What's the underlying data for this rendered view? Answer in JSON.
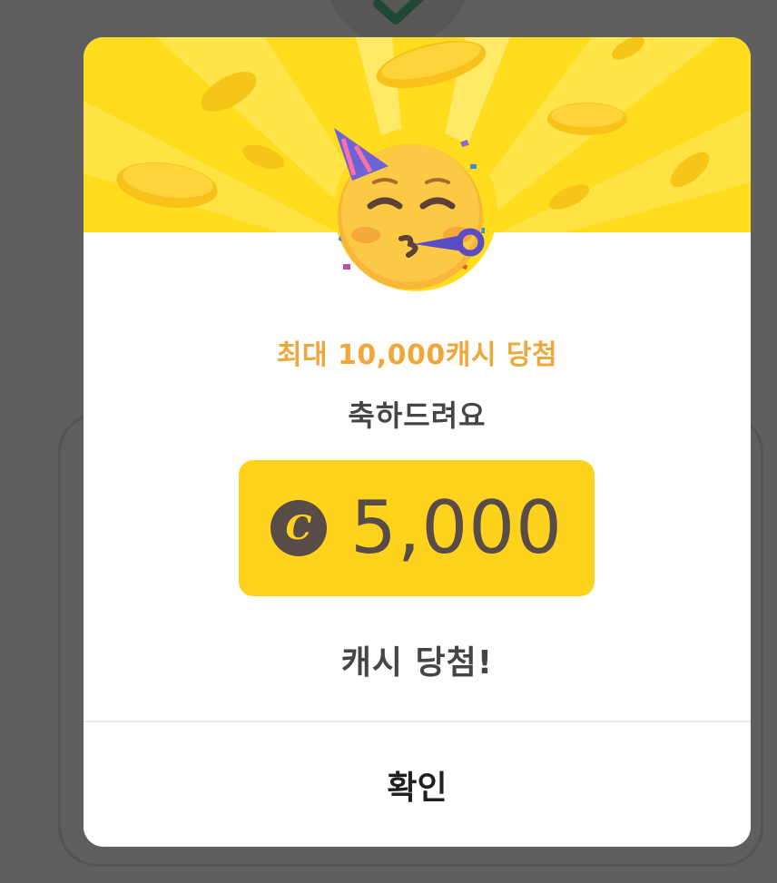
{
  "colors": {
    "overlay": "#5f5f5f",
    "modal_background": "#ffffff",
    "banner": "#ffdc1e",
    "accent_orange": "#f0a73a",
    "amount_box": "#ffd21e",
    "amount_text": "#584c49",
    "heading_text": "#454545"
  },
  "background": {
    "status_icon": "check-icon"
  },
  "modal": {
    "banner_icon": "party-face-icon",
    "subtitle": "최대 10,000캐시 당첨",
    "headline": "축하드려요",
    "amount": {
      "coin_icon": "cash-coin-icon",
      "coin_letter": "C",
      "value": "5,000"
    },
    "result_text": "캐시 당첨!",
    "confirm_label": "확인"
  }
}
